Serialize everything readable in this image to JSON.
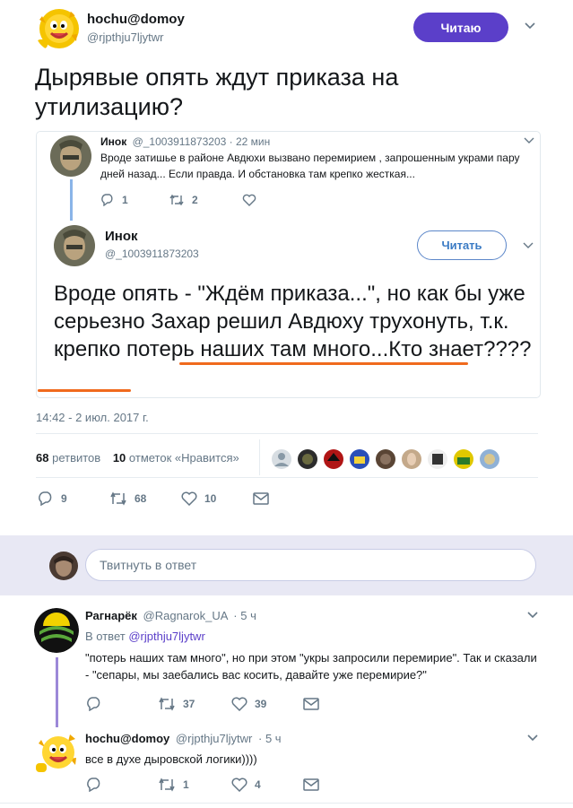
{
  "tweet": {
    "author_name": "hochu@domoy",
    "author_handle": "@rjpthju7ljytwr",
    "follow_label": "Читаю",
    "text": "Дырявые опять ждут приказа на утилизацию?",
    "timestamp": "14:42 - 2 июл. 2017 г.",
    "retweets_count": "68",
    "retweets_label": "ретвитов",
    "likes_count": "10",
    "likes_label": "отметок «Нравится»",
    "actions": {
      "replies": "9",
      "retweets": "68",
      "likes": "10"
    }
  },
  "quote": {
    "parent": {
      "author_name": "Инок",
      "author_handle": "@_1003911873203",
      "time": "22 мин",
      "text": "Вроде затишье в районе Авдюхи вызвано перемирием , запрошенным украми пару дней назад... Если правда. И обстановка там крепко жесткая...",
      "replies": "1",
      "retweets": "2"
    },
    "main": {
      "author_name": "Инок",
      "author_handle": "@_1003911873203",
      "follow_label": "Читать",
      "text": "Вроде опять - \"Ждём приказа...\", но как бы уже серьезно Захар решил Авдюху трухонуть, т.к. крепко потерь наших там много...Кто знает????"
    }
  },
  "reply_box": {
    "placeholder": "Твитнуть в ответ"
  },
  "replies": [
    {
      "author_name": "Рагнарёк",
      "author_handle": "@Ragnarok_UA",
      "time": "· 5 ч",
      "in_reply_prefix": "В ответ",
      "in_reply_handle": "@rjpthju7ljytwr",
      "text": "\"потерь наших там много\", но при этом \"укры запросили перемирие\". Так и сказали - \"сепары, мы заебались вас косить, давайте уже перемирие?\"",
      "replies": "",
      "retweets": "37",
      "likes": "39"
    },
    {
      "author_name": "hochu@domoy",
      "author_handle": "@rjpthju7ljytwr",
      "time": "· 5 ч",
      "text": "все в духе дыровской логики))))",
      "replies": "",
      "retweets": "1",
      "likes": "4"
    }
  ],
  "colors": {
    "accent": "#5b3fc9",
    "link": "#3b7bc4",
    "underline": "#f06a1d",
    "thread": "#9c88d8"
  },
  "icons": [
    "sun-face-avatar",
    "chevron-down-icon",
    "reply-icon",
    "retweet-icon",
    "like-icon",
    "message-icon"
  ]
}
